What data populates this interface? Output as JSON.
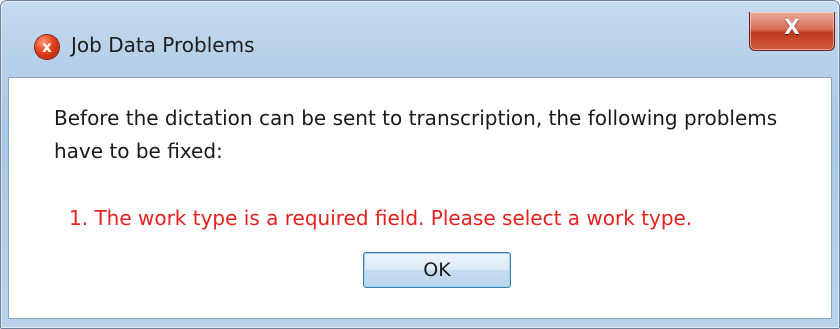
{
  "window": {
    "title": "Job Data Problems",
    "app_icon_glyph": "x",
    "close_glyph": "X"
  },
  "dialog": {
    "message": "Before the dictation can be sent to transcription, the following problems have to be fixed:",
    "problems": [
      "1.  The work type is a required field.  Please select a work type."
    ],
    "ok_label": "OK"
  },
  "colors": {
    "problem_text": "#e8211f",
    "close_button": "#c1391c",
    "titlebar": "#b6d0e9"
  }
}
